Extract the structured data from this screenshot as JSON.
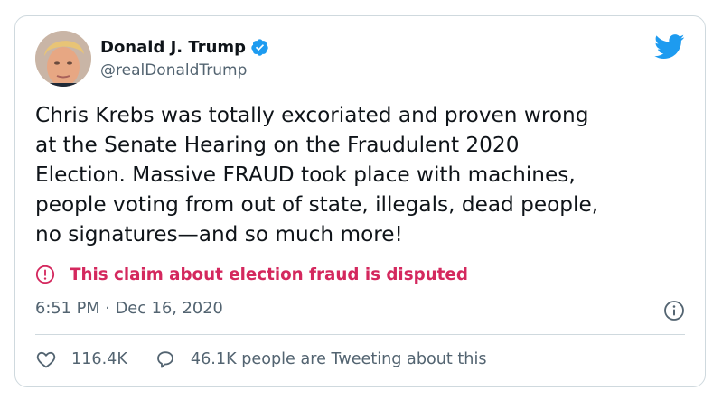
{
  "tweet": {
    "author": {
      "display_name": "Donald J. Trump",
      "handle": "@realDonaldTrump",
      "verified": true
    },
    "text": "Chris Krebs was totally excoriated and proven wrong\nat the Senate Hearing on the Fraudulent 2020\nElection. Massive FRAUD took place with machines,\npeople voting from out of state, illegals, dead people,\nno signatures—and so much more!",
    "warning": {
      "text": "This claim about election fraud is disputed",
      "color": "#d4285e"
    },
    "timestamp": "6:51 PM · Dec 16, 2020",
    "likes": "116.4K",
    "conversation": "46.1K people are Tweeting about this"
  },
  "colors": {
    "brand": "#1d9bf0",
    "text": "#0f1419",
    "muted": "#536471",
    "border": "#cfd9de"
  },
  "icons": {
    "logo": "twitter-bird-icon",
    "verified": "verified-badge-icon",
    "warning": "exclamation-circle-icon",
    "info": "info-icon",
    "like": "heart-icon",
    "conversation": "speech-bubble-icon"
  }
}
